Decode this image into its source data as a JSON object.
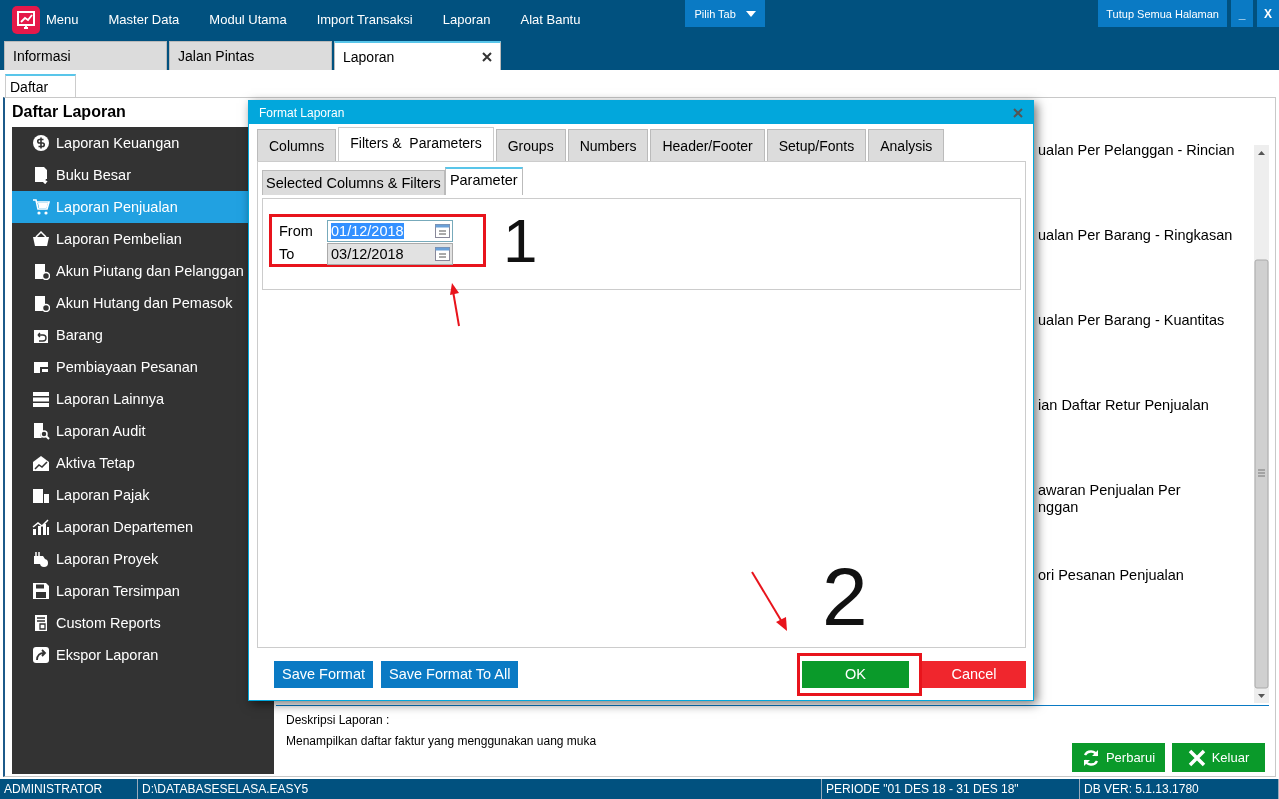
{
  "menu_bar": {
    "items": [
      {
        "label": "Menu"
      },
      {
        "label": "Master Data"
      },
      {
        "label": "Modul Utama"
      },
      {
        "label": "Import Transaksi"
      },
      {
        "label": "Laporan"
      },
      {
        "label": "Alat Bantu"
      }
    ],
    "tab_picker": {
      "label": "Pilih Tab"
    },
    "buttons": [
      "Tutup Semua Halaman",
      "_",
      "X"
    ]
  },
  "page_tabs": [
    {
      "label": "Informasi",
      "selected": false,
      "closable": false
    },
    {
      "label": "Jalan Pintas",
      "selected": false,
      "closable": false
    },
    {
      "label": "Laporan",
      "selected": true,
      "closable": true
    }
  ],
  "sub_tabs": [
    {
      "label": "Daftar",
      "selected": true
    }
  ],
  "sidebar": {
    "title": "Daftar Laporan",
    "items": [
      {
        "label": "Laporan Keuangan",
        "selected": false
      },
      {
        "label": "Buku Besar",
        "selected": false
      },
      {
        "label": "Laporan Penjualan",
        "selected": true
      },
      {
        "label": "Laporan Pembelian",
        "selected": false
      },
      {
        "label": "Akun Piutang dan Pelanggan",
        "selected": false
      },
      {
        "label": "Akun Hutang dan Pemasok",
        "selected": false
      },
      {
        "label": "Barang",
        "selected": false
      },
      {
        "label": "Pembiayaan Pesanan",
        "selected": false
      },
      {
        "label": "Laporan Lainnya",
        "selected": false
      },
      {
        "label": "Laporan Audit",
        "selected": false
      },
      {
        "label": "Aktiva Tetap",
        "selected": false
      },
      {
        "label": "Laporan Pajak",
        "selected": false
      },
      {
        "label": "Laporan Departemen",
        "selected": false
      },
      {
        "label": "Laporan Proyek",
        "selected": false
      },
      {
        "label": "Laporan Tersimpan",
        "selected": false
      },
      {
        "label": "Custom Reports",
        "selected": false
      },
      {
        "label": "Ekspor Laporan",
        "selected": false
      }
    ]
  },
  "report_list": {
    "items": [
      "ualan Per Pelanggan - Rincian",
      "ualan Per Barang - Ringkasan",
      "ualan Per Barang - Kuantitas",
      "ian Daftar Retur Penjualan",
      "awaran Penjualan Per\nnggan",
      "ori Pesanan Penjualan"
    ]
  },
  "description": {
    "label": "Deskripsi Laporan :",
    "text": "Menampilkan daftar faktur yang menggunakan uang muka"
  },
  "actions": [
    {
      "label": "Perbarui",
      "kind": "refresh"
    },
    {
      "label": "Keluar",
      "kind": "exit"
    }
  ],
  "status_bar": [
    "ADMINISTRATOR",
    "D:\\DATABASESELASA.EASY5",
    "PERIODE \"01 DES 18 - 31 DES 18\"",
    "DB VER: 5.1.13.1780"
  ],
  "dialog": {
    "title": "Format Laporan",
    "tabs": [
      {
        "label": "Columns",
        "selected": false
      },
      {
        "label": "Filters &  Parameters",
        "selected": true
      },
      {
        "label": "Groups",
        "selected": false
      },
      {
        "label": "Numbers",
        "selected": false
      },
      {
        "label": "Header/Footer",
        "selected": false
      },
      {
        "label": "Setup/Fonts",
        "selected": false
      },
      {
        "label": "Analysis",
        "selected": false
      }
    ],
    "sub_tabs": [
      {
        "label": "Selected Columns & Filters",
        "selected": false
      },
      {
        "label": "Parameter",
        "selected": true
      }
    ],
    "parameters": {
      "highlighted": true,
      "fields": [
        {
          "label": "From",
          "value": "01/12/2018",
          "focused": true
        },
        {
          "label": "To",
          "value": "03/12/2018",
          "focused": false
        }
      ]
    },
    "buttons": [
      {
        "label": "Save Format",
        "kind": "secondary",
        "highlighted": false
      },
      {
        "label": "Save Format To All",
        "kind": "secondary",
        "highlighted": false
      },
      {
        "label": "OK",
        "kind": "confirm",
        "highlighted": true
      },
      {
        "label": "Cancel",
        "kind": "cancel",
        "highlighted": false
      }
    ]
  },
  "annotations": [
    {
      "kind": "number",
      "text": "1"
    },
    {
      "kind": "arrow"
    },
    {
      "kind": "number",
      "text": "2"
    },
    {
      "kind": "arrow"
    }
  ]
}
